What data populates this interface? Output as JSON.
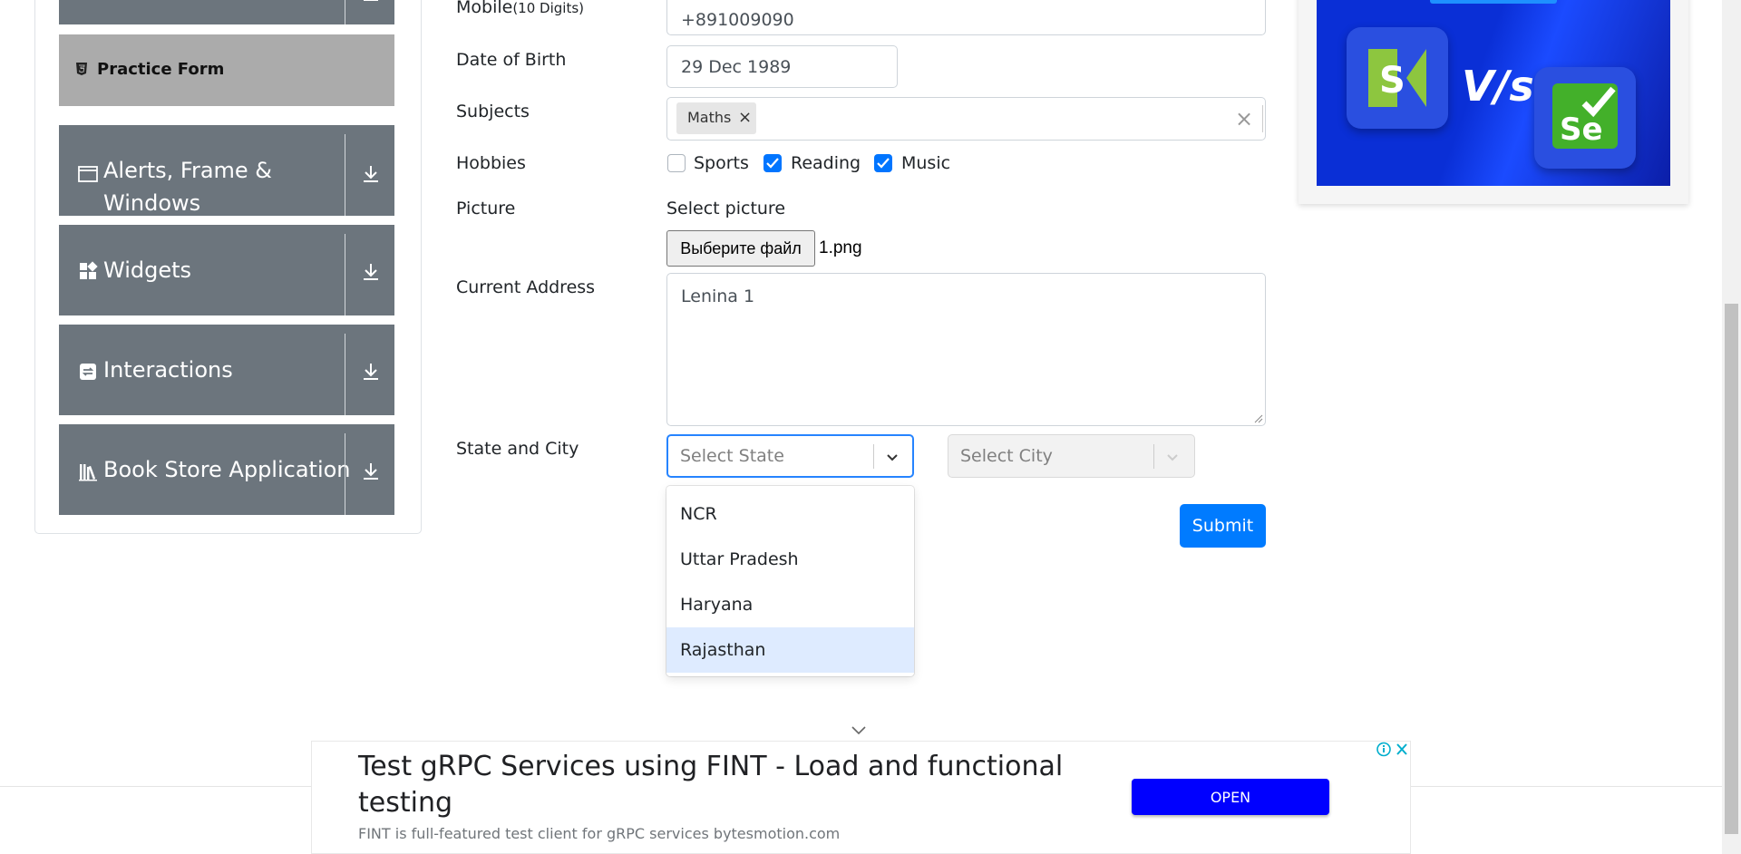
{
  "sidebar": {
    "active_item": "Practice Form",
    "groups": [
      {
        "label_line1": "Alerts, Frame &",
        "label_line2": "Windows",
        "icon": "window-icon"
      },
      {
        "label": "Widgets",
        "icon": "widgets-icon"
      },
      {
        "label": "Interactions",
        "icon": "interactions-icon"
      },
      {
        "label": "Book Store Application",
        "icon": "books-icon"
      }
    ]
  },
  "form": {
    "mobile": {
      "label": "Mobile",
      "hint": "(10 Digits)",
      "value": "+891009090"
    },
    "dob": {
      "label": "Date of Birth",
      "value": "29 Dec 1989"
    },
    "subjects": {
      "label": "Subjects",
      "chip": "Maths",
      "chip_remove": "×",
      "clear": "×"
    },
    "hobbies": {
      "label": "Hobbies",
      "options": [
        {
          "label": "Sports",
          "checked": false
        },
        {
          "label": "Reading",
          "checked": true
        },
        {
          "label": "Music",
          "checked": true
        }
      ]
    },
    "picture": {
      "label": "Picture",
      "caption": "Select picture",
      "button": "Выберите файл",
      "file": "1.png"
    },
    "address": {
      "label": "Current Address",
      "value": "Lenina 1"
    },
    "state_city": {
      "label": "State and City",
      "state_placeholder": "Select State",
      "city_placeholder": "Select City",
      "state_options": [
        "NCR",
        "Uttar Pradesh",
        "Haryana",
        "Rajasthan"
      ],
      "highlighted": "Rajasthan"
    },
    "submit": "Submit"
  },
  "banner": {
    "vs_text": "V/s",
    "se_text": "Se",
    "s_text": "S"
  },
  "ad": {
    "title": "Test gRPC Services using FINT - Load and functional testing",
    "subtitle": "FINT is full-featured test client for gRPC services bytesmotion.com",
    "open": "OPEN"
  },
  "colors": {
    "primary": "#007bff",
    "sidebar_group": "#6c757d",
    "sidebar_active": "#ababab",
    "option_highlight": "#deebff",
    "ad_button": "#0000ff"
  }
}
